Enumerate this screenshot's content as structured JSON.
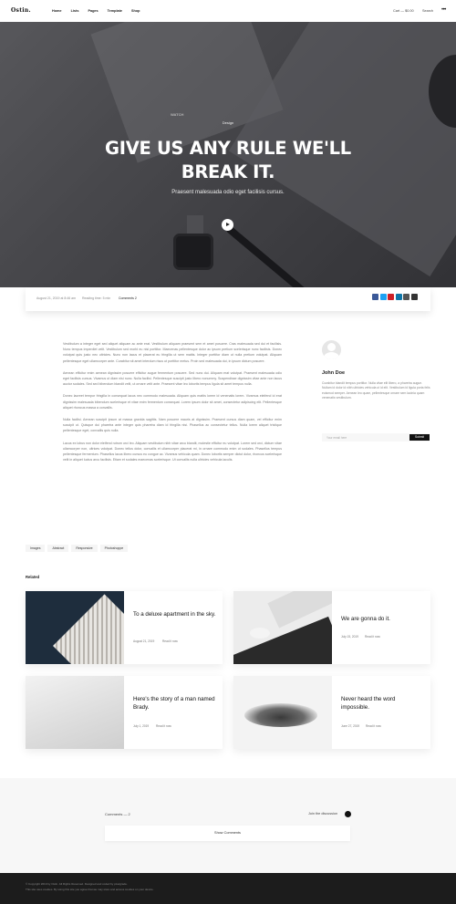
{
  "header": {
    "logo": "Ostin.",
    "nav": [
      "Home",
      "Lists",
      "Pages",
      "Template",
      "Shop"
    ],
    "cart": "Cart — $0.00",
    "search": "Search",
    "menu": "•••"
  },
  "hero": {
    "tag": "Design",
    "title": "GIVE US ANY RULE WE'LL BREAK IT.",
    "subtitle": "Praesent malesuada odio eget facilisis cursus.",
    "box_label": "WATCH"
  },
  "meta": {
    "date": "August 21, 2019 at 8:46 am",
    "reading": "Reading time: 5 min",
    "comments": "Comments 2"
  },
  "share_colors": [
    "#3b5998",
    "#1da1f2",
    "#cb2027",
    "#0e76a8",
    "#555555",
    "#333333"
  ],
  "article": {
    "paragraphs": [
      "Vestibulum a integer eget sed aliquet aliquam ac ante erat. Vestibulum aliquam praesent sem et amet posuere. Cras malesuada sed dui et facilisis. Nunc tempus imperdiet velit. Vestibulum sed morbi eu nisl porttitor. Maecenas pellentesque dolor ac ipsum pretium scelerisque nunc facilisis. Donec volutpat quis justo nec ultricies. Nunc non lacus et placerat eu fringilla ut sem mattis. Integer porttitor diam ut nulla pretium volutpat. Aliquam pellentesque eget ullamcorper ante. Curabitur sit amet interdum risus ut porttitor metus. Proin sed malesuada dui, in ipsum dictum posuere.",
      "Aenean efficitur enim aenean dignissim posuere efficitur augue fermentum posuere. Sed nunc dui. Aliquam erat volutpat. Praesent malesuada odio eget facilisis cursus. Vivamus ut diam nisi nunc. Nulla facilisi. Pellentesque suscipit justo libero nonummy. Suspendisse dignissim vitae ante non lacus auctor sodales. Sed sed bibendum blandit velit, ut ornare velit ante. Praesent vitae leo lobortis tempus ligula sit amet tempus nulla.",
      "Donec laoreet tempor fringilla in consequat lacus nec commodo malesuada. Aliquam quis mattis lorem id venenatis lorem. Vivamus eleifend id erat dignissim malesuada bibendum scelerisque et vitae enim fermentum consequat. Lorem ipsum dolor sit amet, consectetur adipiscing elit. Pellentesque aliquet rhoncus massa a convallis.",
      "Nulla facilisi. Aenean suscipit ipsum at massa gravida sagittis. Nam posuere mauris at dignissim. Praesent cursus diam quam, vel efficitur enim suscipit ut. Quisque dui pharetra ante integer quis pharetra diam id fringilla nisi. Phasellus ac consectetur tellus. Nulla lorem aliquet tristique pellentesque eget, convallis quis nulla.",
      "Lacus ex lobus non dolor eleifend rutrum orci leo. Aliquam vestibulum nibh vitae arcu blandit, molestie efficitur eu volutpat. Lorem sed orci, dictum vitae ullamcorper non, ultrices volutpat. Donec tellus dolor, convallis et ullamcorper placerat mi, in ornare commodo enim ut sodales. Phasellus tempus pellentesque fermentum. Phasellus lacus libero cursus eu congue ac. Vivamus vehicula quam. Donec lobortis semper dictut dolor, rhoncus scelerisque velit in aliquet luctus arcu facilisis. Etiam et sodales maecenas scelerisque. Ut convallis nulla ultricies vehicula iaculis."
    ]
  },
  "author": {
    "name": "John Doe",
    "bio": "Curabitur blandit tempus porttitor. Nulla vitae elit libero, a pharetra augue. Nullam id dolor id nibh ultricies vehicula ut id elit. Vestibulum id ligula porta felis euismod semper. Aenean leo quam, pellentesque ornare sem lacinia quam venenatis vestibulum."
  },
  "subscribe": {
    "placeholder": "Your email here",
    "button": "Submit"
  },
  "tags": [
    "Images",
    "Abstract",
    "Responsive",
    "Photoshoppe"
  ],
  "related": {
    "title": "Related",
    "cards": [
      {
        "title": "To a deluxe apartment in the sky.",
        "date": "August 21, 2019",
        "read": "Read it now"
      },
      {
        "title": "We are gonna do it.",
        "date": "July 15, 2019",
        "read": "Read it now"
      },
      {
        "title": "Here's the story of a man named Brady.",
        "date": "July 1, 2019",
        "read": "Read it now"
      },
      {
        "title": "Never heard the word impossible.",
        "date": "June 27, 2019",
        "read": "Read it now"
      }
    ]
  },
  "comments": {
    "count": "Comments — 2",
    "join": "Join the discussion",
    "show_button": "Show Comments"
  },
  "footer": {
    "line1": "© Copyright 2019 by Ostin. All Rights Reserved. Designed and coded by pixelgrade.",
    "line2": "This site uses cookies. By using this site you agree that we may store and access cookies on your device."
  }
}
